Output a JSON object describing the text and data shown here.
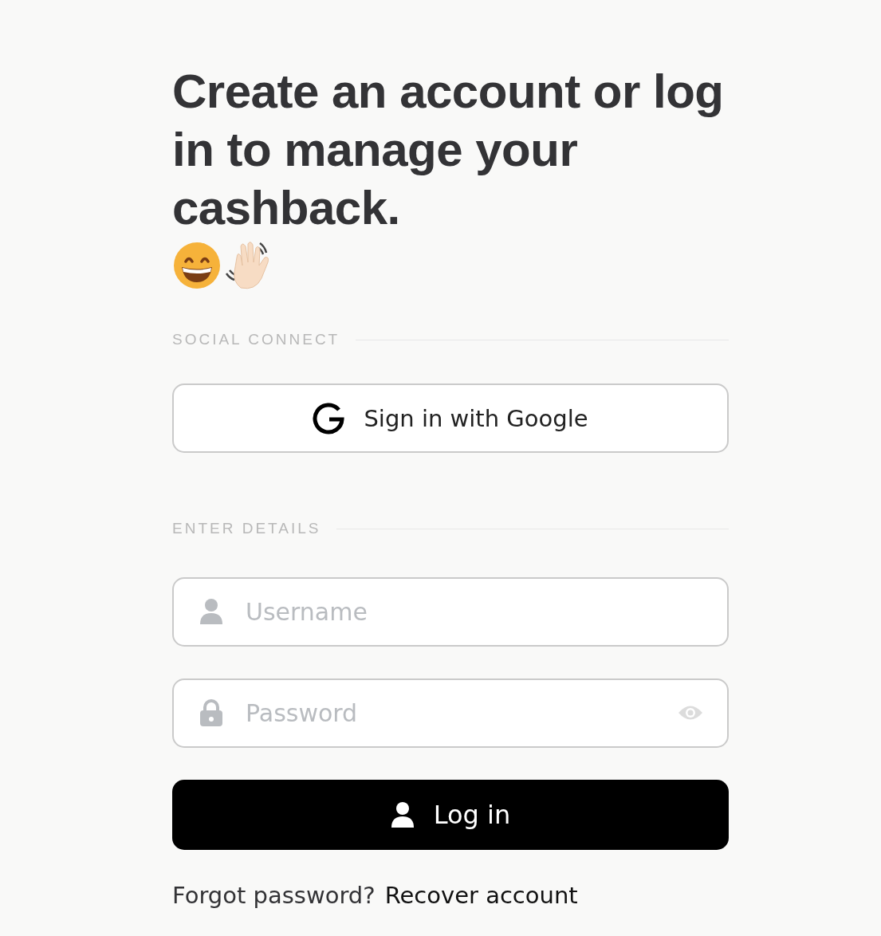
{
  "heading": "Create an account or log in to manage your cashback.",
  "social_section": {
    "label": "SOCIAL CONNECT",
    "google_button": "Sign in with Google"
  },
  "details_section": {
    "label": "ENTER DETAILS",
    "fields": [
      {
        "kind": "username",
        "placeholder": "Username"
      },
      {
        "kind": "password",
        "placeholder": "Password"
      }
    ],
    "login_button": "Log in"
  },
  "recovery": {
    "prompt": "Forgot password?",
    "link": "Recover account"
  }
}
